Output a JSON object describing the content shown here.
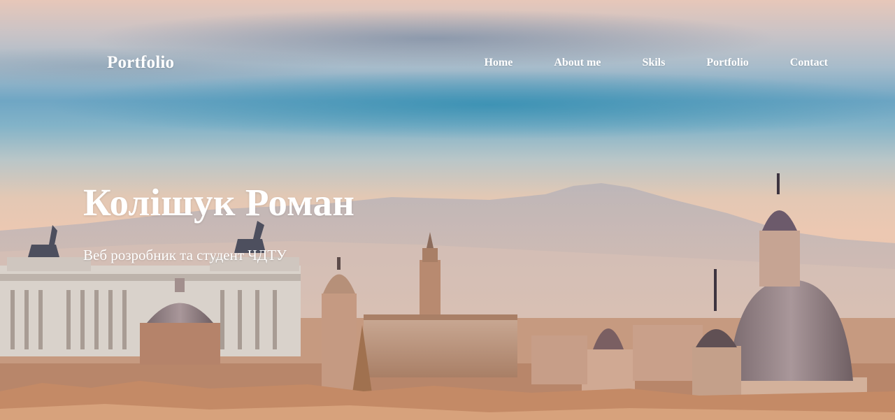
{
  "header": {
    "logo": "Portfolio",
    "nav": [
      {
        "label": "Home"
      },
      {
        "label": "About me"
      },
      {
        "label": "Skils"
      },
      {
        "label": "Portfolio"
      },
      {
        "label": "Contact"
      }
    ]
  },
  "hero": {
    "title": "Колішук Роман",
    "subtitle": "Веб розробник та студент ЧДТУ",
    "background": "rome-cityscape-photo"
  },
  "colors": {
    "text": "#ffffff",
    "sky_blue": "#3f95b8",
    "haze_pink": "#e9c4ad"
  }
}
